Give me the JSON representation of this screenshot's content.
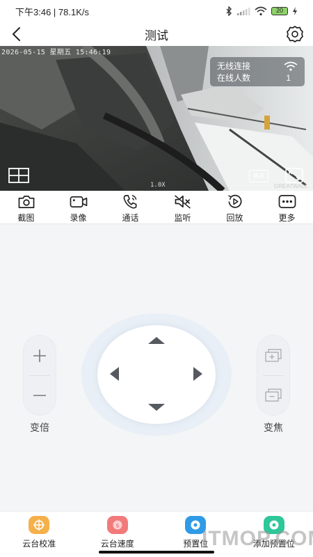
{
  "status_bar": {
    "time": "下午3:46 | 78.1K/s",
    "battery": "20"
  },
  "header": {
    "title": "测试"
  },
  "video": {
    "osd_timestamp": "2026-05-15 星期五 15:46:19",
    "network": {
      "type_label": "无线连接",
      "online_label": "在线人数",
      "online_count": "1"
    },
    "quality_label": "高清",
    "zoom_text": "1.0X",
    "brand": "GREATWALL"
  },
  "toolbar": {
    "items": [
      {
        "label": "截图",
        "icon": "camera-icon"
      },
      {
        "label": "录像",
        "icon": "video-record-icon"
      },
      {
        "label": "通话",
        "icon": "phone-icon"
      },
      {
        "label": "监听",
        "icon": "speaker-muted-icon"
      },
      {
        "label": "回放",
        "icon": "playback-icon"
      },
      {
        "label": "更多",
        "icon": "more-icon"
      }
    ]
  },
  "ptz": {
    "zoom_label": "变倍",
    "focus_label": "变焦"
  },
  "bottom_bar": {
    "items": [
      {
        "label": "云台校准",
        "icon": "calibrate-icon",
        "color": "#f5b04a"
      },
      {
        "label": "云台速度",
        "icon": "speed-icon",
        "color": "#f27a7a"
      },
      {
        "label": "预置位",
        "icon": "preset-icon",
        "color": "#2f9be6"
      },
      {
        "label": "添加预置位",
        "icon": "add-preset-icon",
        "color": "#2ec79a"
      }
    ]
  },
  "watermark": "ITMOP.COM",
  "colors": {
    "accent_blue": "#2f9be6",
    "icon_dark": "#333333"
  }
}
